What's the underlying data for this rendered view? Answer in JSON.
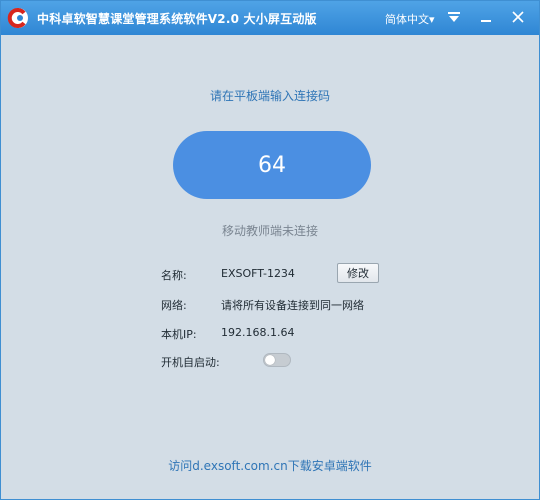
{
  "window": {
    "title": "中科卓软智慧课堂管理系统软件V2.0 大小屏互动版",
    "language": "简体中文▾"
  },
  "main": {
    "prompt": "请在平板端输入连接码",
    "code": "64",
    "status": "移动教师端未连接"
  },
  "info": {
    "name_label": "名称:",
    "name_value": "EXSOFT-1234",
    "edit_label": "修改",
    "network_label": "网络:",
    "network_value": "请将所有设备连接到同一网络",
    "ip_label": "本机IP:",
    "ip_value": "192.168.1.64",
    "autostart_label": "开机自启动:",
    "autostart_enabled": false
  },
  "footer": {
    "link": "访问d.exsoft.com.cn下载安卓端软件"
  },
  "colors": {
    "titlebar": "#3b93dc",
    "code_pill": "#4b8fe2",
    "link": "#2f75b6",
    "background": "#d3dde6"
  }
}
